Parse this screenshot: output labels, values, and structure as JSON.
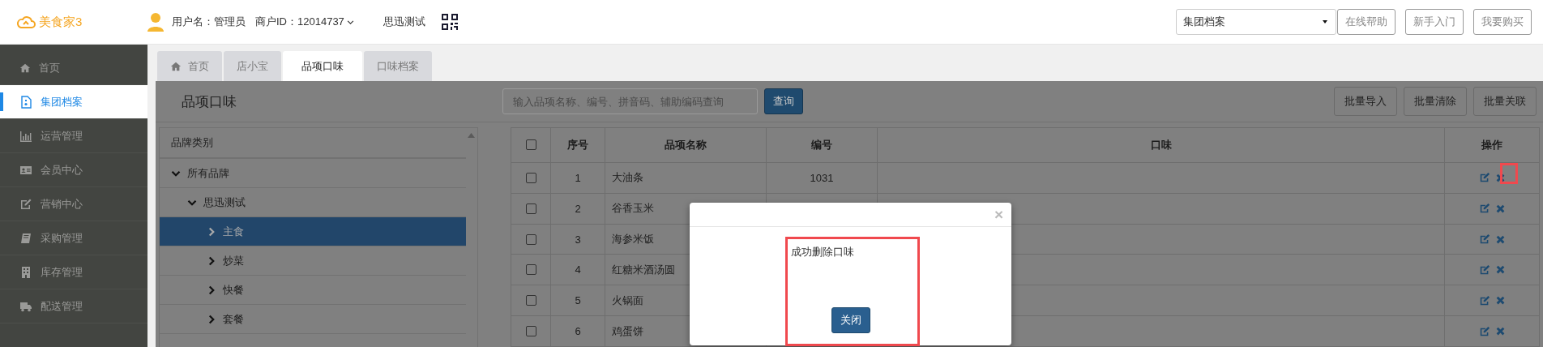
{
  "app": {
    "logo": "美食家3"
  },
  "user": {
    "username": "用户名：管理员",
    "merchant": "商户ID：12014737",
    "store": "思迅测试"
  },
  "top_select": {
    "value": "集团档案"
  },
  "top_buttons": [
    "在线帮助",
    "新手入门",
    "我要购买"
  ],
  "sidebar": {
    "items": [
      {
        "label": "首页",
        "selected": false
      },
      {
        "label": "集团档案",
        "selected": true
      },
      {
        "label": "运营管理",
        "selected": false
      },
      {
        "label": "会员中心",
        "selected": false
      },
      {
        "label": "营销中心",
        "selected": false
      },
      {
        "label": "采购管理",
        "selected": false
      },
      {
        "label": "库存管理",
        "selected": false
      },
      {
        "label": "配送管理",
        "selected": false
      }
    ]
  },
  "tabs": [
    {
      "label": "首页",
      "selected": false
    },
    {
      "label": "店小宝",
      "selected": false
    },
    {
      "label": "品项口味",
      "selected": true
    },
    {
      "label": "口味档案",
      "selected": false
    }
  ],
  "page": {
    "title": "品项口味",
    "search": {
      "placeholder": "输入品项名称、编号、拼音码、辅助编码查询"
    },
    "search_button": "查询",
    "actions": [
      "批量导入",
      "批量清除",
      "批量关联"
    ]
  },
  "tree": {
    "header": "品牌类别",
    "items": [
      {
        "label": "所有品牌",
        "expanded": true,
        "selected": false,
        "children": [
          {
            "label": "思迅测试",
            "expanded": true,
            "selected": false,
            "children": [
              {
                "label": "主食",
                "expanded": false,
                "selected": true
              },
              {
                "label": "炒菜",
                "expanded": false,
                "selected": false
              },
              {
                "label": "快餐",
                "expanded": false,
                "selected": false
              },
              {
                "label": "套餐",
                "expanded": false,
                "selected": false
              }
            ]
          }
        ]
      }
    ]
  },
  "table": {
    "select_all": {
      "checked": false
    },
    "columns": [
      "序号",
      "品项名称",
      "编号",
      "口味",
      "操作"
    ],
    "rows": [
      {
        "checked": false,
        "no": "1",
        "name": "大油条",
        "code": "1031"
      },
      {
        "checked": false,
        "no": "2",
        "name": "谷香玉米"
      },
      {
        "checked": false,
        "no": "3",
        "name": "海参米饭"
      },
      {
        "checked": false,
        "no": "4",
        "name": "红糖米酒汤圆"
      },
      {
        "checked": false,
        "no": "5",
        "name": "火锅面"
      },
      {
        "checked": false,
        "no": "6",
        "name": "鸡蛋饼"
      }
    ]
  },
  "dialog": {
    "close": "×",
    "message": "成功删除口味",
    "button": "关闭"
  }
}
